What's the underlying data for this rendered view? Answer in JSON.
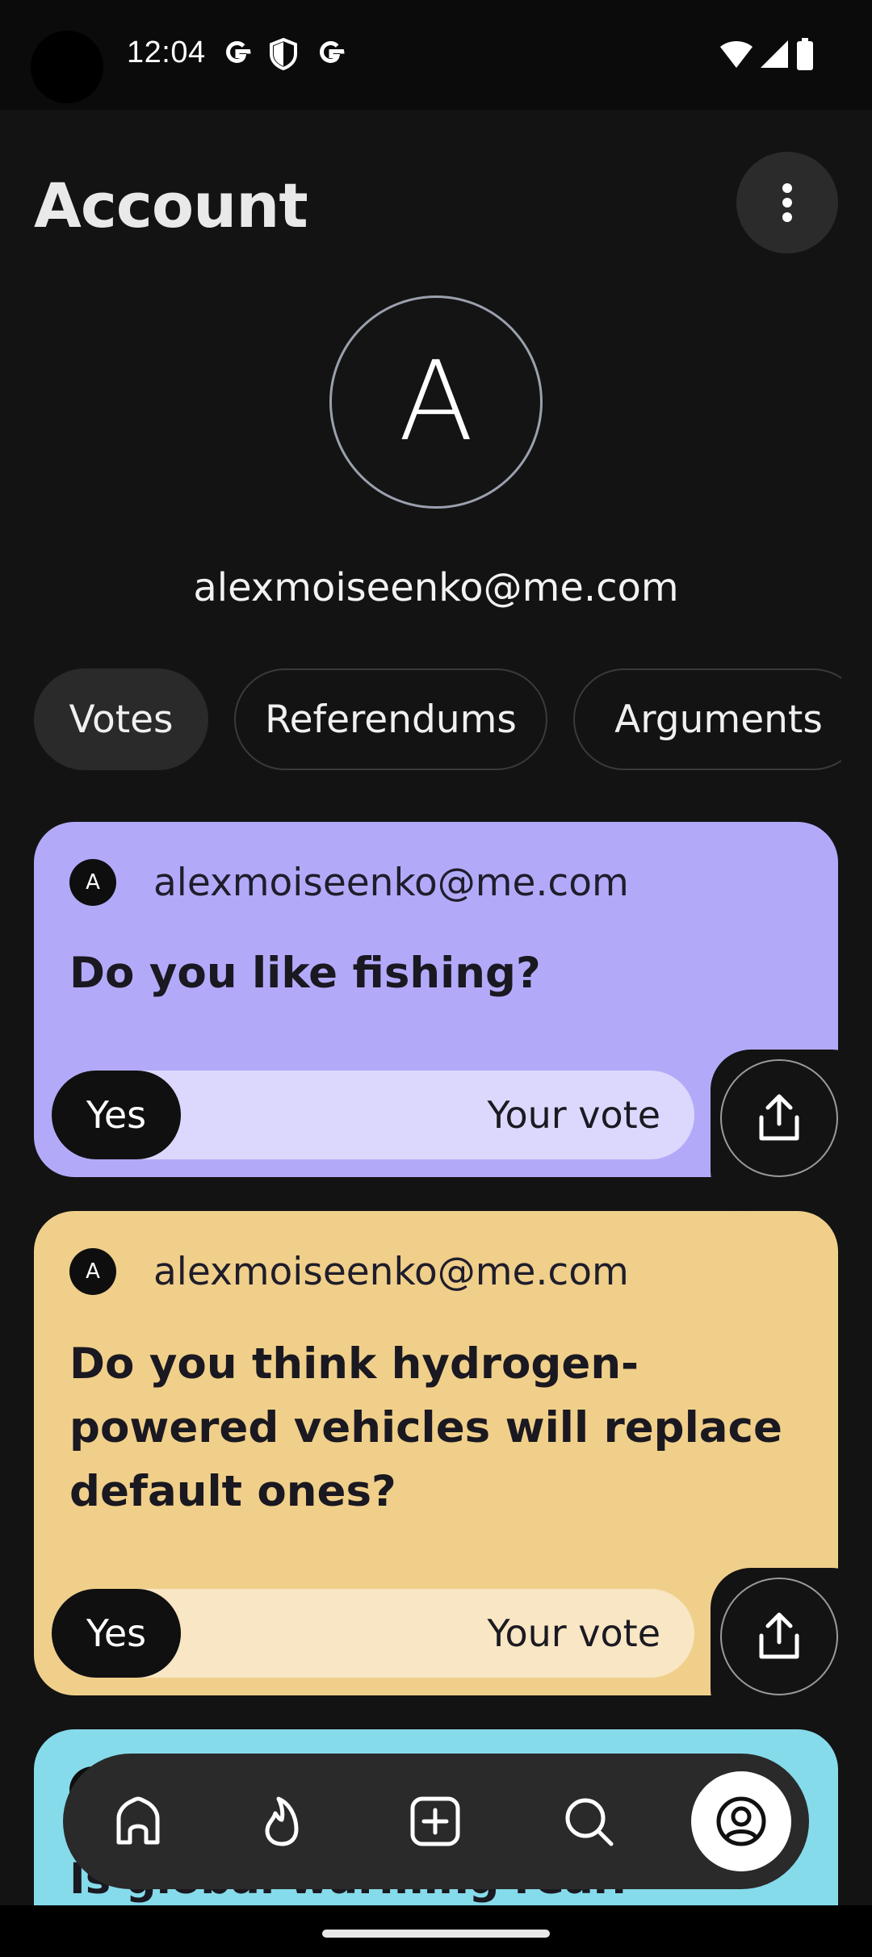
{
  "status_bar": {
    "time": "12:04",
    "icons": [
      "google-g-icon",
      "shield-icon",
      "google-g-icon",
      "wifi-icon",
      "signal-icon",
      "battery-icon"
    ]
  },
  "header": {
    "title": "Account",
    "menu_icon": "more-vertical-icon"
  },
  "profile": {
    "avatar_letter": "A",
    "email": "alexmoiseenko@me.com"
  },
  "tabs": [
    {
      "label": "Votes",
      "active": true
    },
    {
      "label": "Referendums",
      "active": false
    },
    {
      "label": "Arguments",
      "active": false
    }
  ],
  "cards": [
    {
      "author_initial": "A",
      "author_email": "alexmoiseenko@me.com",
      "question": "Do you like fishing?",
      "vote_choice": "Yes",
      "vote_label": "Your vote",
      "color": "#b2aaf9",
      "bar_color": "#dcd8fd"
    },
    {
      "author_initial": "A",
      "author_email": "alexmoiseenko@me.com",
      "question": "Do you think hydrogen-powered vehicles will replace default ones?",
      "vote_choice": "Yes",
      "vote_label": "Your vote",
      "color": "#f0cf8a",
      "bar_color": "#f8e6c4"
    },
    {
      "author_initial": "A",
      "author_email": "",
      "question": "Is global warming real?",
      "color": "#86dbeb"
    }
  ],
  "bottom_nav": {
    "items": [
      "home-icon",
      "flame-icon",
      "add-square-icon",
      "search-icon",
      "profile-icon"
    ],
    "active": "profile-icon"
  }
}
